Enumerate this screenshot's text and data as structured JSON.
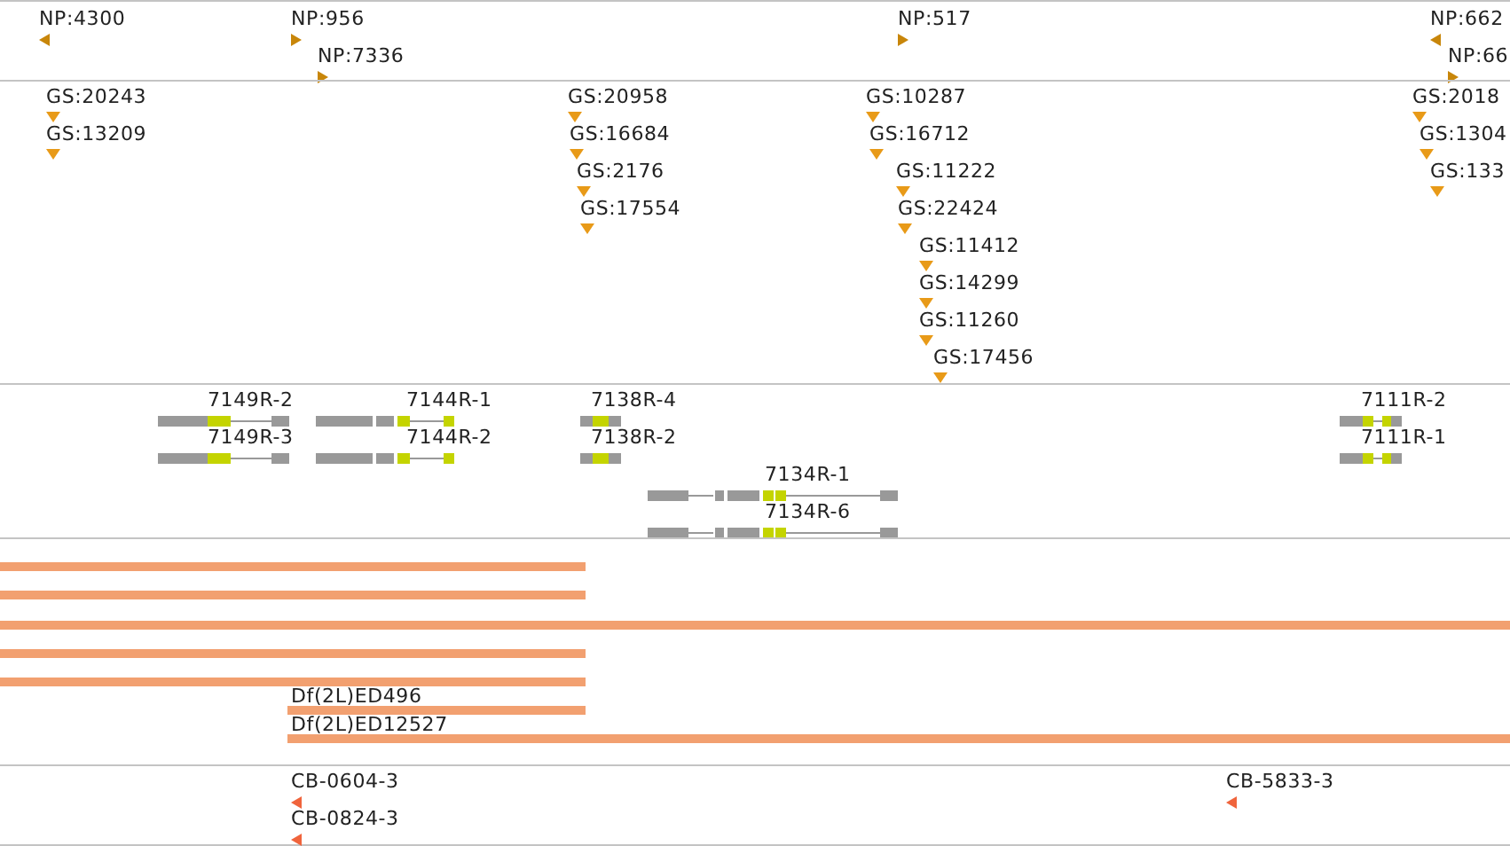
{
  "tracks": [
    {
      "kind": "markers",
      "color": "#c8860a",
      "features": [
        {
          "label": "NP:4300",
          "kind": "left"
        },
        {
          "label": "NP:956",
          "kind": "right"
        },
        {
          "label": "NP:7336",
          "kind": "right"
        },
        {
          "label": "NP:517",
          "kind": "right"
        },
        {
          "label": "NP:662",
          "kind": "left"
        },
        {
          "label": "NP:66",
          "kind": "right"
        }
      ]
    },
    {
      "kind": "markers",
      "color": "#e89a18",
      "features": [
        {
          "label": "GS:20243",
          "kind": "down"
        },
        {
          "label": "GS:13209",
          "kind": "down"
        },
        {
          "label": "GS:20958",
          "kind": "down"
        },
        {
          "label": "GS:16684",
          "kind": "down"
        },
        {
          "label": "GS:2176",
          "kind": "down"
        },
        {
          "label": "GS:17554",
          "kind": "down"
        },
        {
          "label": "GS:10287",
          "kind": "down"
        },
        {
          "label": "GS:16712",
          "kind": "down"
        },
        {
          "label": "GS:11222",
          "kind": "down"
        },
        {
          "label": "GS:22424",
          "kind": "down"
        },
        {
          "label": "GS:11412",
          "kind": "down"
        },
        {
          "label": "GS:14299",
          "kind": "down"
        },
        {
          "label": "GS:11260",
          "kind": "down"
        },
        {
          "label": "GS:17456",
          "kind": "down"
        },
        {
          "label": "GS:2018",
          "kind": "down"
        },
        {
          "label": "GS:1304",
          "kind": "down"
        },
        {
          "label": "GS:133",
          "kind": "down"
        }
      ]
    },
    {
      "kind": "transcripts",
      "color": "#c4d400",
      "features": [
        {
          "label": "7149R-2"
        },
        {
          "label": "7149R-3"
        },
        {
          "label": "7144R-1"
        },
        {
          "label": "7144R-2"
        },
        {
          "label": "7138R-4"
        },
        {
          "label": "7138R-2"
        },
        {
          "label": "7134R-1"
        },
        {
          "label": "7134R-6"
        },
        {
          "label": "7111R-2"
        },
        {
          "label": "7111R-1"
        }
      ]
    },
    {
      "kind": "bars",
      "color": "#f2a070",
      "features": [
        {
          "kind": "deletion"
        },
        {
          "kind": "deletion"
        },
        {
          "kind": "deletion"
        },
        {
          "kind": "deletion"
        },
        {
          "kind": "deletion"
        },
        {
          "kind": "deletion",
          "label": "Df(2L)ED496"
        },
        {
          "kind": "deletion",
          "label": "Df(2L)ED12527"
        }
      ]
    },
    {
      "kind": "markers",
      "color": "#f0643c",
      "features": [
        {
          "label": "CB-0604-3",
          "kind": "left"
        },
        {
          "label": "CB-0824-3",
          "kind": "left"
        },
        {
          "label": "CB-5833-3",
          "kind": "left"
        }
      ]
    }
  ]
}
